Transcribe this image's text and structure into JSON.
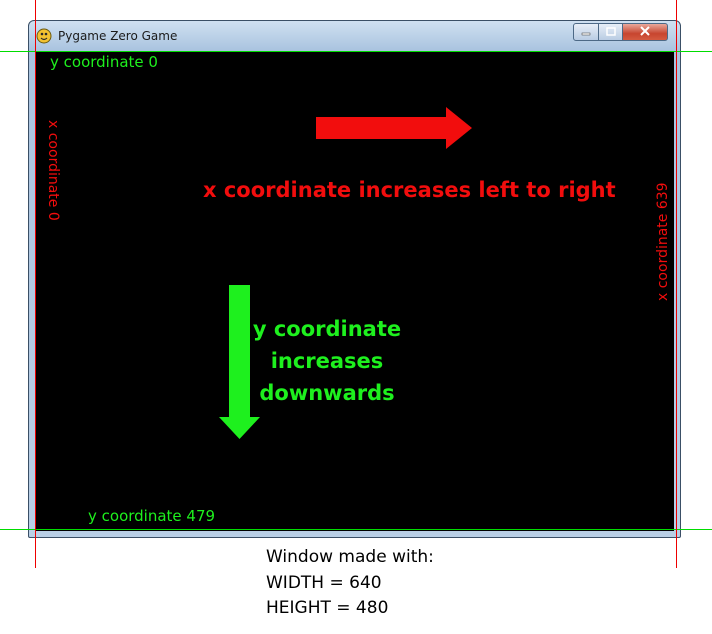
{
  "window": {
    "title": "Pygame Zero Game",
    "buttons": {
      "minimize": "minimize-icon",
      "maximize": "maximize-icon",
      "close": "close-icon"
    }
  },
  "canvas": {
    "labels": {
      "y_top": "y coordinate 0",
      "y_bottom": "y coordinate 479",
      "x_left": "x coordinate 0",
      "x_right": "x coordinate 639",
      "x_increase": "x coordinate increases left to right",
      "y_increase_line1": "y coordinate",
      "y_increase_line2": "increases",
      "y_increase_line3": "downwards"
    },
    "colors": {
      "green": "#1ef01e",
      "red": "#f20d0d",
      "background": "#000000"
    },
    "arrows": {
      "x_direction": "right-arrow-icon",
      "y_direction": "down-arrow-icon"
    }
  },
  "caption": {
    "line1": "Window made with:",
    "line2": "WIDTH = 640",
    "line3": "HEIGHT = 480"
  }
}
